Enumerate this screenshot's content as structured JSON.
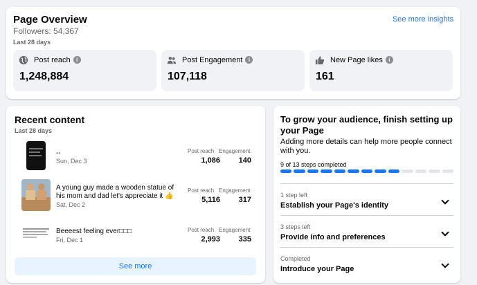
{
  "overview": {
    "title": "Page Overview",
    "followers": "Followers: 54,367",
    "period": "Last 28 days",
    "insights_link": "See more insights",
    "stats": [
      {
        "label": "Post reach",
        "value": "1,248,884",
        "icon": "globe-icon"
      },
      {
        "label": "Post Engagement",
        "value": "107,118",
        "icon": "people-icon"
      },
      {
        "label": "New Page likes",
        "value": "161",
        "icon": "thumbs-up-icon"
      }
    ],
    "info_glyph": "i"
  },
  "recent": {
    "title": "Recent content",
    "period": "Last 28 days",
    "reach_label": "Post reach",
    "engagement_label": "Engagement",
    "posts": [
      {
        "title": "--",
        "date": "Sun, Dec 3",
        "reach": "1,086",
        "engagement": "140"
      },
      {
        "title": "A young guy made a wooden statue of his mom and dad let's appreciate it 👍",
        "date": "Sat, Dec 2",
        "reach": "5,116",
        "engagement": "317"
      },
      {
        "title": "Beeeest feeling ever□□□",
        "date": "Fri, Dec 1",
        "reach": "2,993",
        "engagement": "335"
      }
    ],
    "see_more": "See more"
  },
  "setup": {
    "title": "To grow your audience, finish setting up your Page",
    "subtitle": "Adding more details can help more people connect with you.",
    "progress_label": "9 of 13 steps completed",
    "progress": {
      "done": 9,
      "total": 13
    },
    "steps": [
      {
        "status": "1 step left",
        "name": "Establish your Page's identity"
      },
      {
        "status": "3 steps left",
        "name": "Provide info and preferences"
      },
      {
        "status": "Completed",
        "name": "Introduce your Page"
      }
    ]
  },
  "colors": {
    "accent": "#1877f2",
    "link": "#1b74e4",
    "background": "#f0f2f5"
  }
}
